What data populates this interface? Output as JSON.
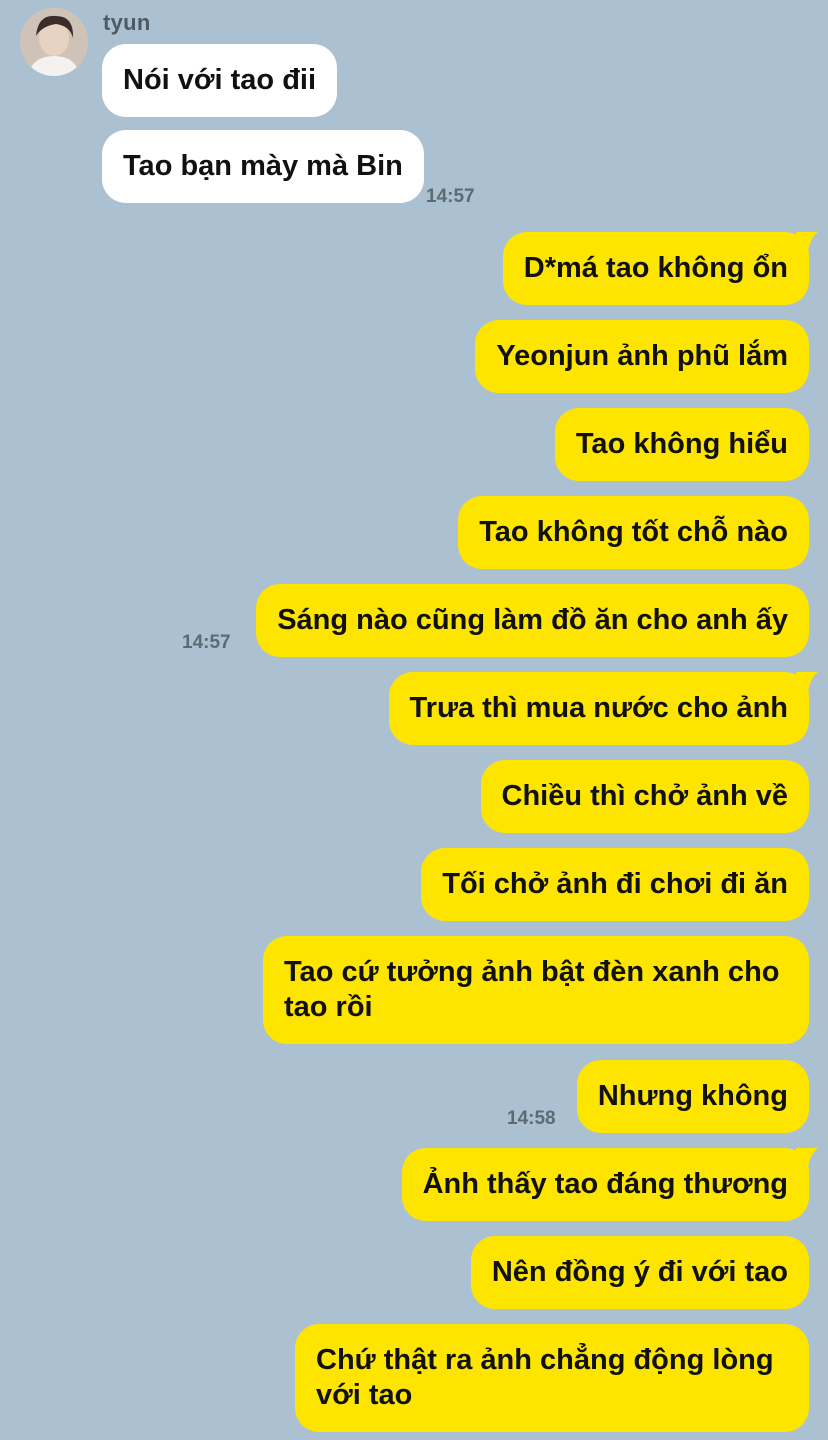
{
  "contact": {
    "name": "tyun",
    "avatar_icon": "profile-photo"
  },
  "incoming": [
    {
      "text": "Nói với tao đii"
    },
    {
      "text": "Tao bạn mày mà Bin"
    }
  ],
  "incoming_time": "14:57",
  "outgoing": [
    {
      "text": "D*má tao không ổn"
    },
    {
      "text": "Yeonjun ảnh phũ lắm"
    },
    {
      "text": "Tao không hiểu"
    },
    {
      "text": "Tao không tốt chỗ nào"
    },
    {
      "text": "Sáng nào cũng làm đồ ăn cho anh ấy"
    },
    {
      "text": "Trưa thì mua nước cho ảnh"
    },
    {
      "text": "Chiều thì chở ảnh về"
    },
    {
      "text": "Tối chở ảnh đi chơi đi ăn"
    },
    {
      "text": "Tao cứ tưởng ảnh bật đèn xanh cho tao rồi"
    },
    {
      "text": "Nhưng không"
    },
    {
      "text": "Ảnh thấy tao đáng thương"
    },
    {
      "text": "Nên đồng ý đi với tao"
    },
    {
      "text": "Chứ thật ra ảnh chẳng động lòng với tao"
    }
  ],
  "outgoing_times": [
    "14:57",
    "14:58"
  ],
  "colors": {
    "background": "#abc1d1",
    "outgoing_bubble": "#fee500",
    "incoming_bubble": "#ffffff"
  }
}
